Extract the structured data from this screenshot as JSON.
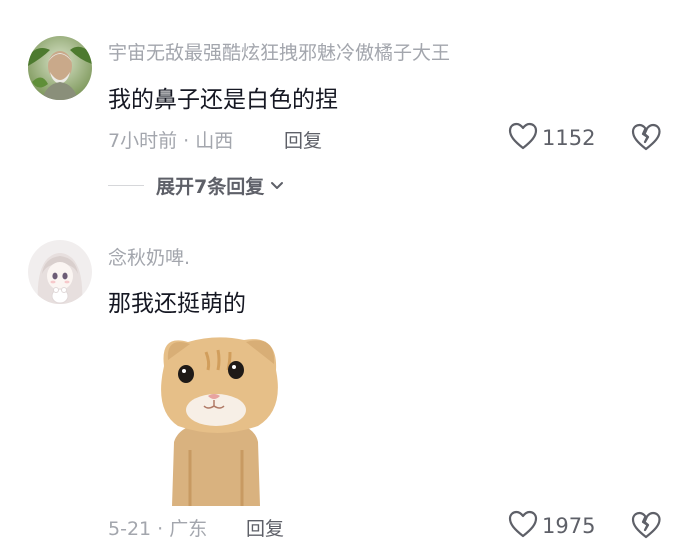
{
  "comments": [
    {
      "username": "宇宙无敌最强酷炫狂拽邪魅冷傲橘子大王",
      "text": "我的鼻子还是白色的捏",
      "time_location": "7小时前 · 山西",
      "reply_label": "回复",
      "like_count": "1152",
      "expand_label": "展开7条回复",
      "avatar_icon": "person-portrait-avatar",
      "like_icon": "heart-outline-icon",
      "dislike_icon": "broken-heart-icon"
    },
    {
      "username": "念秋奶啤.",
      "text": "那我还挺萌的",
      "time_location": "5-21 · 广东",
      "reply_label": "回复",
      "like_count": "1975",
      "sticker": "orange-kitten-sticker",
      "avatar_icon": "anime-girl-avatar",
      "like_icon": "heart-outline-icon",
      "dislike_icon": "broken-heart-icon"
    }
  ],
  "colors": {
    "primary_text": "#161823",
    "secondary_text": "#a3a6ad",
    "action_text": "#5e6068"
  }
}
